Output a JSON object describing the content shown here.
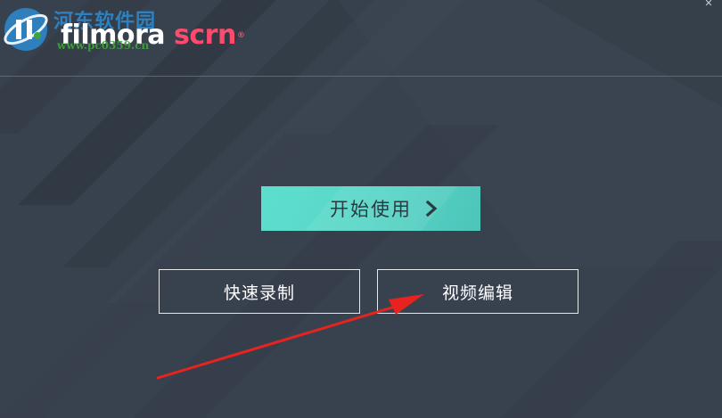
{
  "brand": {
    "name_part1": "filmora",
    "name_part2": "scrn",
    "trademark": "®"
  },
  "watermark": {
    "site_name": "河东软件园",
    "url": "www.pc0359.cn"
  },
  "window": {
    "close_glyph": "✕"
  },
  "main": {
    "start_button_label": "开始使用",
    "quick_record_label": "快速录制",
    "video_edit_label": "视频编辑"
  },
  "colors": {
    "background": "#39434f",
    "accent_teal": "#5ddfcd",
    "brand_pink": "#ff4a6e",
    "divider": "#c4385f",
    "annotation_arrow": "#e8231f"
  },
  "icons": {
    "start_chevron": "chevron-right-icon",
    "window_close": "close-icon",
    "watermark_logo": "watermark-logo-icon"
  }
}
